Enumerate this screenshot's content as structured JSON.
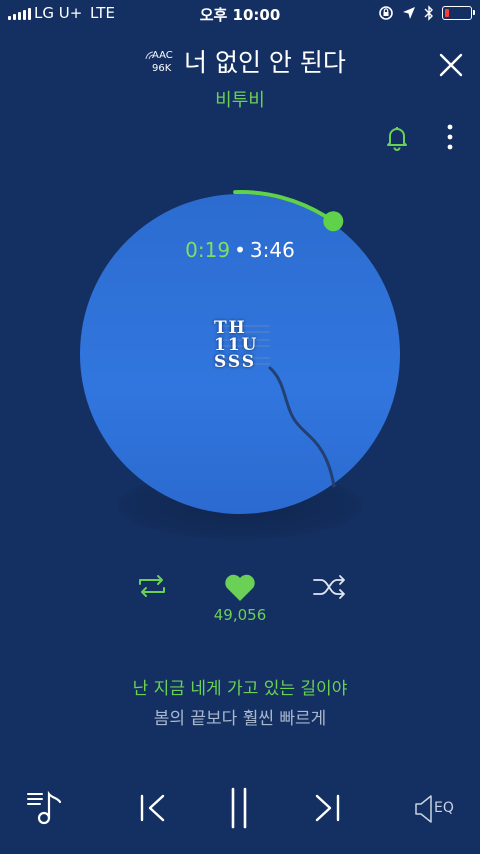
{
  "status_bar": {
    "carrier": "LG U+",
    "network": "LTE",
    "time": "오후 10:00",
    "battery_level": 0.15
  },
  "header": {
    "codec": "AAC",
    "bitrate": "96K",
    "title": "너 없인 안 된다",
    "artist": "비투비"
  },
  "player": {
    "current_time": "0:19",
    "separator": "•",
    "total_time": "3:46",
    "progress": 0.084,
    "album_letters": [
      "TH",
      "11U",
      "SSS"
    ],
    "like_count": "49,056"
  },
  "lyrics": {
    "current": "난 지금 네게 가고 있는 길이야",
    "next": "봄의 끝보다 훨씬 빠르게"
  },
  "bottom_bar": {
    "eq_label": "EQ"
  },
  "icons": {
    "close": "close-icon",
    "bell": "bell-icon",
    "more": "more-vertical-icon",
    "repeat": "repeat-icon",
    "like": "heart-icon",
    "shuffle": "shuffle-icon",
    "playlist": "playlist-icon",
    "prev": "previous-icon",
    "pause": "pause-icon",
    "next": "next-icon",
    "eq": "equalizer-icon"
  },
  "colors": {
    "background": "#143063",
    "accent": "#6ad056",
    "disc": "#2f72d8"
  }
}
